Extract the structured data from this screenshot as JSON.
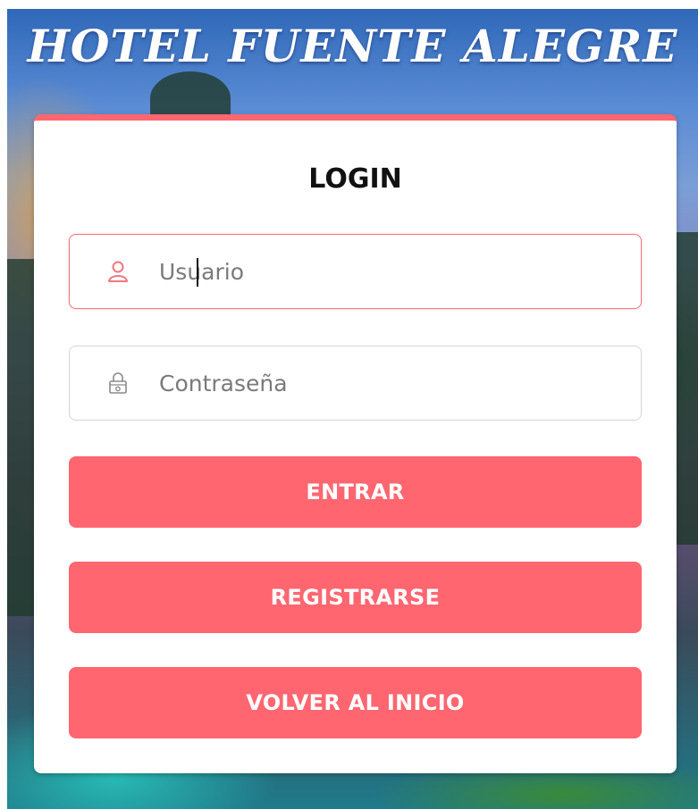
{
  "hotel": {
    "title": "HOTEL FUENTE ALEGRE"
  },
  "login": {
    "heading": "LOGIN",
    "username_placeholder": "Usuario",
    "username_value": "",
    "password_placeholder": "Contraseña",
    "password_value": "",
    "buttons": {
      "enter": "ENTRAR",
      "register": "REGISTRARSE",
      "back": "VOLVER AL INICIO"
    }
  },
  "icons": {
    "username": "user-icon",
    "password": "lock-icon"
  },
  "colors": {
    "accent": "#ff6670",
    "active_border": "#f0787e",
    "heading": "#111111"
  }
}
